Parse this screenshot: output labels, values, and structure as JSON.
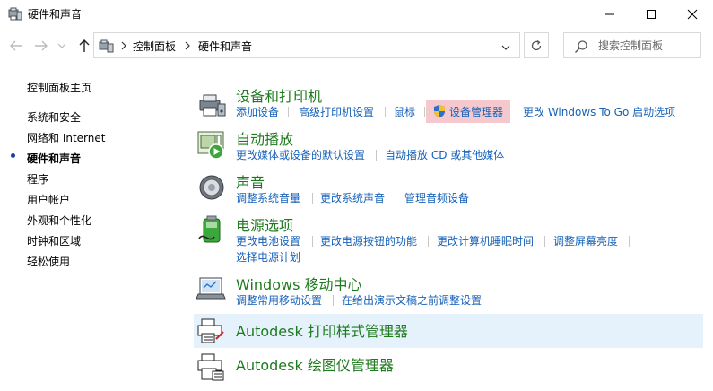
{
  "window": {
    "title": "硬件和声音"
  },
  "address": {
    "crumbs": [
      "控制面板",
      "硬件和声音"
    ]
  },
  "search": {
    "placeholder": "搜索控制面板"
  },
  "sidebar": {
    "items": [
      {
        "label": "控制面板主页"
      },
      {
        "label": "系统和安全"
      },
      {
        "label": "网络和 Internet"
      },
      {
        "label": "硬件和声音"
      },
      {
        "label": "程序"
      },
      {
        "label": "用户帐户"
      },
      {
        "label": "外观和个性化"
      },
      {
        "label": "时钟和区域"
      },
      {
        "label": "轻松使用"
      }
    ],
    "current_index": 3
  },
  "categories": [
    {
      "title": "设备和打印机",
      "icon": "printer-device-icon",
      "links": [
        "添加设备",
        "高级打印机设置",
        "鼠标",
        "设备管理器",
        "更改 Windows To Go 启动选项"
      ]
    },
    {
      "title": "自动播放",
      "icon": "autoplay-icon",
      "links": [
        "更改媒体或设备的默认设置",
        "自动播放 CD 或其他媒体"
      ]
    },
    {
      "title": "声音",
      "icon": "speaker-icon",
      "links": [
        "调整系统音量",
        "更改系统声音",
        "管理音频设备"
      ]
    },
    {
      "title": "电源选项",
      "icon": "battery-icon",
      "links": [
        "更改电池设置",
        "更改电源按钮的功能",
        "更改计算机睡眠时间",
        "调整屏幕亮度",
        "选择电源计划"
      ]
    },
    {
      "title": "Windows 移动中心",
      "icon": "mobility-center-icon",
      "links": [
        "调整常用移动设置",
        "在给出演示文稿之前调整设置"
      ]
    },
    {
      "title": "Autodesk 打印样式管理器",
      "icon": "autodesk-printer-icon",
      "links": []
    },
    {
      "title": "Autodesk 绘图仪管理器",
      "icon": "autodesk-plotter-icon",
      "links": []
    }
  ],
  "colors": {
    "category_title": "#1e7a1e",
    "link": "#1762b8",
    "highlight_row": "#e6f2fb",
    "highlight_link": "#f4c8cc"
  }
}
